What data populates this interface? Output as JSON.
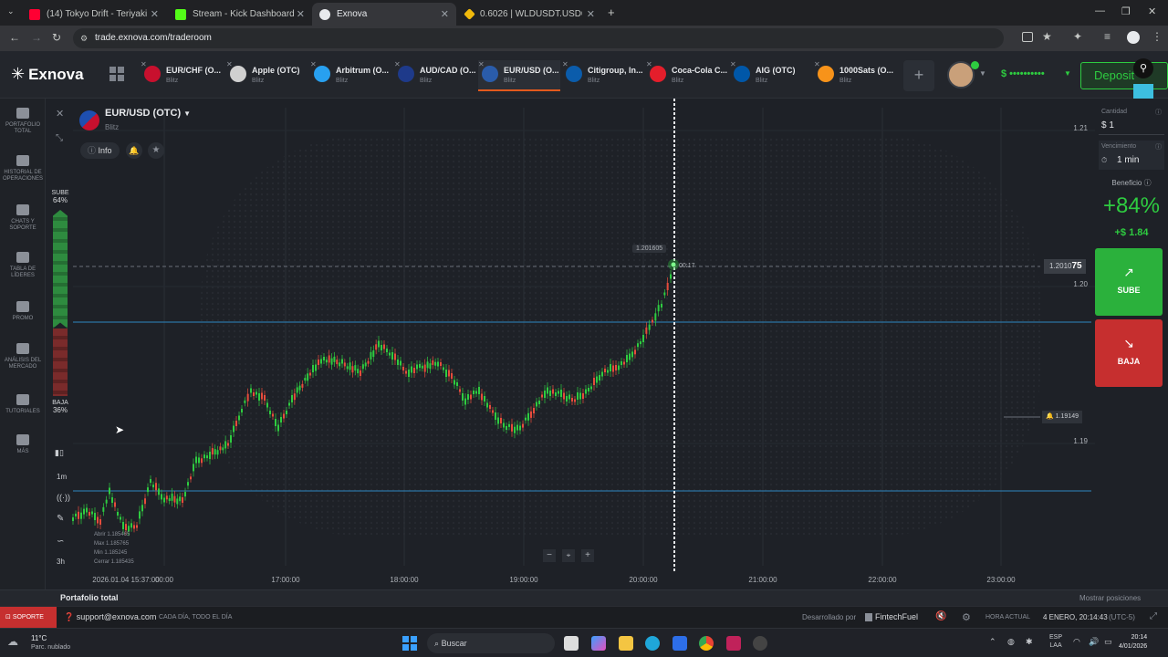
{
  "browser": {
    "tabs": [
      {
        "title": "(14) Tokyo Drift - Teriyaki B",
        "color": "#ff0033"
      },
      {
        "title": "Stream - Kick Dashboard",
        "color": "#53fc18"
      },
      {
        "title": "Exnova",
        "color": "#e8eaed"
      },
      {
        "title": "0.6026 | WLDUSDT.USD©-Marg",
        "color": "#f0b90b"
      }
    ],
    "url": "trade.exnova.com/traderoom"
  },
  "app": {
    "brand": "Exnova",
    "assets": [
      {
        "name": "EUR/CHF (O...",
        "mode": "Blitz",
        "color": "#c8102e"
      },
      {
        "name": "Apple (OTC)",
        "mode": "Blitz",
        "color": "#d0d0d0"
      },
      {
        "name": "Arbitrum (O...",
        "mode": "Blitz",
        "color": "#28a0f0"
      },
      {
        "name": "AUD/CAD (O...",
        "mode": "Blitz",
        "color": "#1e3a8a"
      },
      {
        "name": "EUR/USD (O...",
        "mode": "Blitz",
        "color": "#2a5caa"
      },
      {
        "name": "Citigroup, In...",
        "mode": "Blitz",
        "color": "#0b5cab"
      },
      {
        "name": "Coca-Cola C...",
        "mode": "Blitz",
        "color": "#e41e2b"
      },
      {
        "name": "AIG (OTC)",
        "mode": "Blitz",
        "color": "#0057a8"
      },
      {
        "name": "1000Sats (O...",
        "mode": "Blitz",
        "color": "#f7931a"
      }
    ],
    "balance": "$ ••••••••••",
    "deposit_label": "Deposit"
  },
  "sidebar": {
    "items": [
      {
        "label": "PORTAFOLIO TOTAL",
        "icon": "briefcase-icon"
      },
      {
        "label": "HISTORIAL DE OPERACIONES",
        "icon": "history-icon"
      },
      {
        "label": "CHATS Y SOPORTE",
        "icon": "chat-icon"
      },
      {
        "label": "TABLA DE LÍDERES",
        "icon": "trophy-icon"
      },
      {
        "label": "PROMO",
        "icon": "promo-icon"
      },
      {
        "label": "ANÁLISIS DEL MERCADO",
        "icon": "analysis-icon"
      },
      {
        "label": "TUTORIALES",
        "icon": "tutorial-icon"
      },
      {
        "label": "MÁS",
        "icon": "more-icon"
      }
    ]
  },
  "chart_header": {
    "pair": "EUR/USD (OTC)",
    "mode": "Blitz",
    "info_label": "Info"
  },
  "sentiment": {
    "up_label": "SUBE",
    "up_pct": "64%",
    "down_label": "BAJA",
    "down_pct": "36%"
  },
  "tools": [
    "1m",
    "3h"
  ],
  "ohlc": {
    "open": "Abrir 1.185465",
    "max": "Max 1.185765",
    "min": "Min 1.185245",
    "close": "Cerrar 1.185435"
  },
  "chart_data": {
    "type": "line",
    "x": [
      "2026.01.04 15:37:00",
      "00:00",
      "17:00:00",
      "18:00:00",
      "19:00:00",
      "20:00:00",
      "21:00:00",
      "22:00:00",
      "23:00:00"
    ],
    "y_ticks": [
      "1.21",
      "1.20",
      "1.19"
    ],
    "current_price_prefix": "1.2010",
    "current_price_suffix": "75",
    "peak_label": "1.201605",
    "timer": "00:17",
    "alert_price": "1.19149"
  },
  "trade_panel": {
    "amount_label": "Cantidad",
    "amount_value": "$ 1",
    "expiry_label": "Vencimiento",
    "expiry_value": "1 min",
    "profit_label": "Beneficio",
    "profit_pct": "+84%",
    "profit_value": "+$ 1.84",
    "up_button": "SUBE",
    "down_button": "BAJA"
  },
  "bottom": {
    "portfolio": "Portafolio total",
    "positions": "Mostrar posiciones"
  },
  "status": {
    "support": "SOPORTE",
    "email": "support@exnova.com",
    "hours": "CADA DÍA, TODO EL DÍA",
    "developer": "Desarrollado por",
    "fintech": "FintechFuel",
    "time_label": "HORA ACTUAL",
    "time_value": "4 ENERO, 20:14:43",
    "tz": "(UTC-5)"
  },
  "taskbar": {
    "weather_temp": "11°C",
    "weather_desc": "Parc. nublado",
    "search": "Buscar",
    "lang": "ESP",
    "region": "LAA",
    "clock_time": "20:14",
    "clock_date": "4/01/2026"
  }
}
